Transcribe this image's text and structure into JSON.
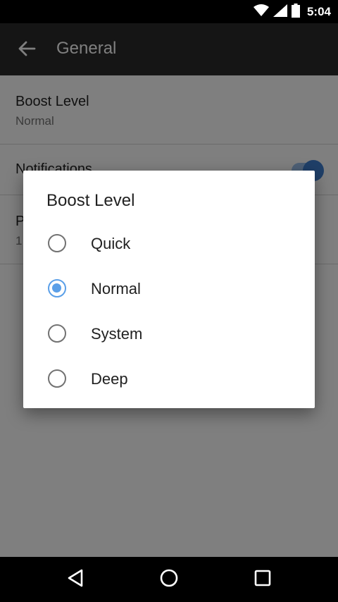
{
  "status_bar": {
    "time": "5:04",
    "icons": [
      "wifi-icon",
      "signal-icon",
      "battery-icon"
    ]
  },
  "app_bar": {
    "title": "General",
    "back_icon": "arrow-left-icon"
  },
  "preferences": [
    {
      "title": "Boost Level",
      "summary": "Normal"
    },
    {
      "title": "Notifications",
      "toggle": true
    },
    {
      "title": "P",
      "summary": "1"
    }
  ],
  "dialog": {
    "title": "Boost Level",
    "options": [
      {
        "label": "Quick",
        "checked": false
      },
      {
        "label": "Normal",
        "checked": true
      },
      {
        "label": "System",
        "checked": false
      },
      {
        "label": "Deep",
        "checked": false
      }
    ]
  },
  "nav_bar": {
    "buttons": [
      "back-triangle-icon",
      "home-circle-icon",
      "recents-square-icon"
    ]
  },
  "colors": {
    "accent": "#5a9fe8",
    "app_bar": "#2b2b2b"
  }
}
